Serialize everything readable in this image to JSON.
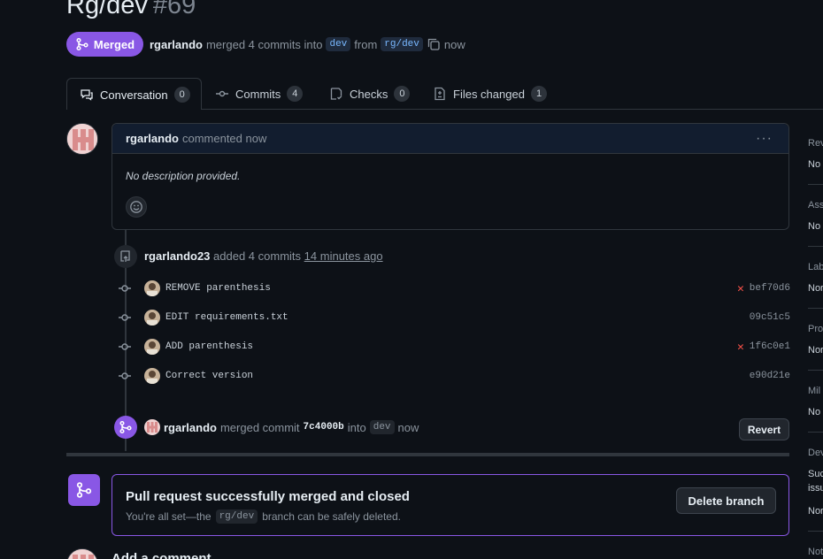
{
  "pr": {
    "title": "Rg/dev",
    "number": "#69",
    "status": "Merged",
    "author": "rgarlando",
    "merge_text": "merged 4 commits into",
    "base_branch": "dev",
    "from_text": "from",
    "head_branch": "rg/dev",
    "time": "now"
  },
  "tabs": [
    {
      "label": "Conversation",
      "count": "0"
    },
    {
      "label": "Commits",
      "count": "4"
    },
    {
      "label": "Checks",
      "count": "0"
    },
    {
      "label": "Files changed",
      "count": "1"
    }
  ],
  "comment": {
    "author": "rgarlando",
    "action": "commented now",
    "body": "No description provided."
  },
  "commit_event": {
    "author": "rgarlando23",
    "action": "added 4 commits",
    "time": "14 minutes ago"
  },
  "commits": [
    {
      "message": "REMOVE parenthesis",
      "sha": "bef70d6",
      "failed": "✕"
    },
    {
      "message": "EDIT requirements.txt",
      "sha": "09c51c5",
      "failed": ""
    },
    {
      "message": "ADD parenthesis",
      "sha": "1f6c0e1",
      "failed": "✕"
    },
    {
      "message": "Correct version",
      "sha": "e90d21e",
      "failed": ""
    }
  ],
  "merge_event": {
    "author": "rgarlando",
    "action": "merged commit",
    "commit": "7c4000b",
    "into": "into",
    "branch": "dev",
    "time": "now",
    "revert_label": "Revert"
  },
  "merged_box": {
    "title": "Pull request successfully merged and closed",
    "text_before": "You're all set—the",
    "branch": "rg/dev",
    "text_after": "branch can be safely deleted.",
    "delete_label": "Delete branch"
  },
  "add_comment": "Add a comment",
  "sidebar": [
    {
      "label": "Rev",
      "value": "No"
    },
    {
      "label": "Ass",
      "value": "No"
    },
    {
      "label": "Lab",
      "value": "Nor"
    },
    {
      "label": "Pro",
      "value": "Nor"
    },
    {
      "label": "Mil",
      "value": "No"
    },
    {
      "label": "Dev",
      "value": "Suc",
      "value2": "issu",
      "value3": "Nor"
    },
    {
      "label": "Not"
    }
  ],
  "colors": {
    "merged_purple": "#8957e5",
    "fail_red": "#f85149",
    "background": "#0d1117"
  }
}
